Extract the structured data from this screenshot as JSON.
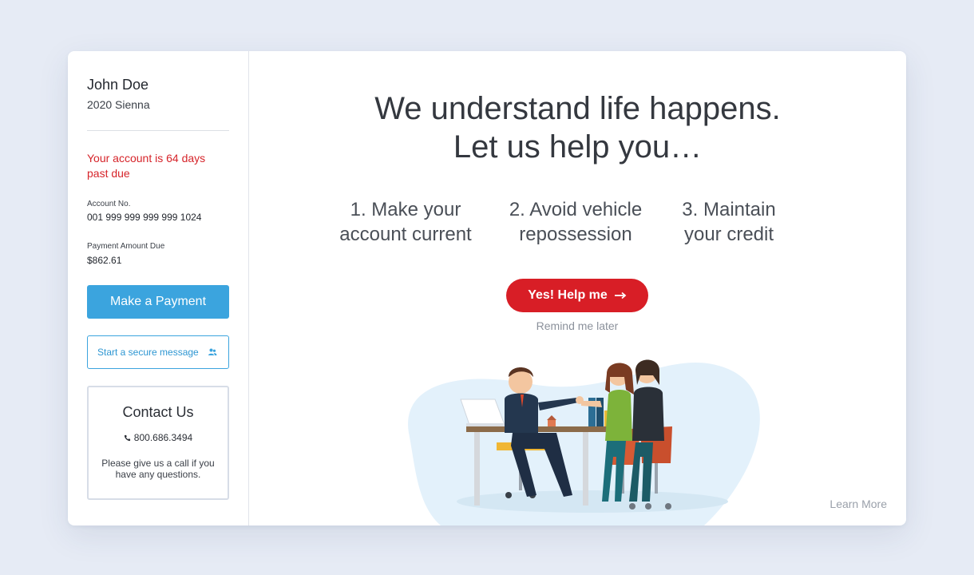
{
  "sidebar": {
    "user_name": "John Doe",
    "vehicle": "2020 Sienna",
    "past_due_message": "Your account is 64 days past due",
    "account_label": "Account No.",
    "account_number": "001 999 999 999 999 1024",
    "amount_label": "Payment Amount Due",
    "amount_value": "$862.61",
    "pay_button": "Make a Payment",
    "message_button": "Start a secure message",
    "message_icon": "users-icon",
    "contact": {
      "title": "Contact Us",
      "phone_icon": "phone-icon",
      "phone": "800.686.3494",
      "note": "Please give us a call if you have any questions."
    }
  },
  "main": {
    "headline_line1": "We understand life happens.",
    "headline_line2": "Let us help you…",
    "steps": [
      {
        "line1": "1. Make your",
        "line2": "account current"
      },
      {
        "line1": "2. Avoid vehicle",
        "line2": "repossession"
      },
      {
        "line1": "3. Maintain",
        "line2": "your credit"
      }
    ],
    "cta_button": "Yes! Help me",
    "cta_icon": "arrow-right-icon",
    "remind_link": "Remind me later",
    "learn_more": "Learn More"
  },
  "colors": {
    "background": "#e6ebf5",
    "accent_blue": "#3ba4de",
    "alert_red": "#d81e26",
    "past_due_red": "#d6242a",
    "muted_gray": "#8b919b"
  }
}
